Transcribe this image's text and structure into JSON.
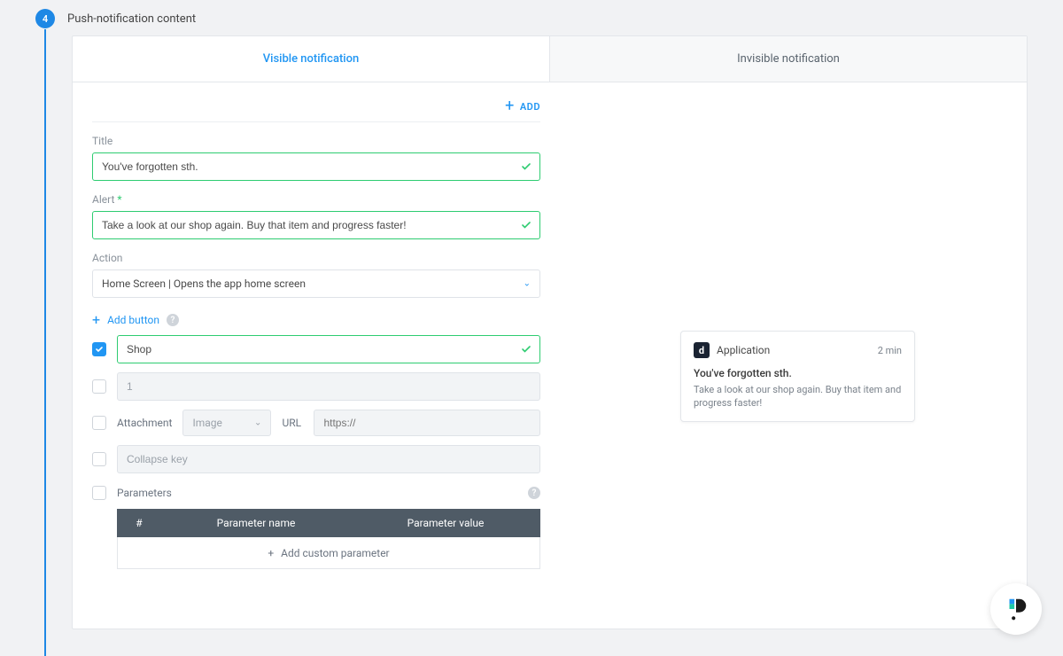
{
  "step": {
    "number": "4",
    "title": "Push-notification content"
  },
  "tabs": {
    "visible": "Visible notification",
    "invisible": "Invisible notification"
  },
  "add_label": "ADD",
  "fields": {
    "title_label": "Title",
    "title_value": "You've forgotten sth.",
    "alert_label": "Alert",
    "alert_required": "*",
    "alert_value": "Take a look at our shop again. Buy that item and progress faster!",
    "action_label": "Action",
    "action_value": "Home Screen | Opens the app home screen"
  },
  "add_button_label": "Add button",
  "button_rows": {
    "row1_value": "Shop",
    "row2_placeholder": "1"
  },
  "attachment": {
    "label": "Attachment",
    "type": "Image",
    "url_label": "URL",
    "url_placeholder": "https://"
  },
  "collapse_placeholder": "Collapse key",
  "parameters_label": "Parameters",
  "param_table": {
    "col_hash": "#",
    "col_name": "Parameter name",
    "col_value": "Parameter value",
    "add_label": "Add custom parameter"
  },
  "preview": {
    "app_name": "Application",
    "time": "2 min",
    "title": "You've forgotten sth.",
    "body": "Take a look at our shop again. Buy that item and progress faster!"
  }
}
